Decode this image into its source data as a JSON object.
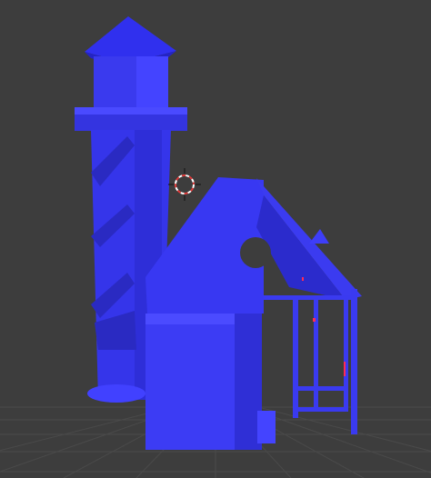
{
  "viewport": {
    "background": "#3d3d3d",
    "grid_color": "#4a4a4a",
    "mesh_color": "#3a3aee",
    "mesh_shade": "#2b2bcc",
    "mesh_light": "#4f4fff",
    "accent_red": "#ff2a55",
    "cursor_colors": [
      "#ffffff",
      "#e03a3a"
    ]
  },
  "icons": {
    "cursor": "3d-cursor-icon"
  }
}
